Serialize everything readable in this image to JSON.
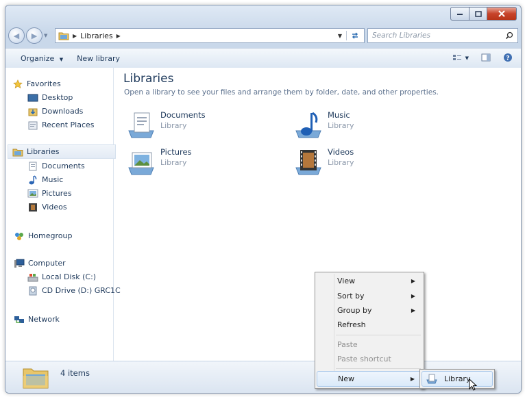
{
  "address": {
    "breadcrumb": "Libraries",
    "search_placeholder": "Search Libraries"
  },
  "toolbar": {
    "organize": "Organize",
    "new_library": "New library"
  },
  "nav": {
    "favorites": "Favorites",
    "desktop": "Desktop",
    "downloads": "Downloads",
    "recent": "Recent Places",
    "libraries": "Libraries",
    "documents": "Documents",
    "music": "Music",
    "pictures": "Pictures",
    "videos": "Videos",
    "homegroup": "Homegroup",
    "computer": "Computer",
    "local_disk": "Local Disk (C:)",
    "cd_drive": "CD Drive (D:) GRC1C",
    "network": "Network"
  },
  "content": {
    "title": "Libraries",
    "description": "Open a library to see your files and arrange them by folder, date, and other properties.",
    "libraries": [
      {
        "name": "Documents",
        "type": "Library"
      },
      {
        "name": "Music",
        "type": "Library"
      },
      {
        "name": "Pictures",
        "type": "Library"
      },
      {
        "name": "Videos",
        "type": "Library"
      }
    ]
  },
  "status": {
    "items": "4 items"
  },
  "context_menu": {
    "view": "View",
    "sort_by": "Sort by",
    "group_by": "Group by",
    "refresh": "Refresh",
    "paste": "Paste",
    "paste_shortcut": "Paste shortcut",
    "new": "New"
  },
  "submenu": {
    "library": "Library"
  },
  "colors": {
    "accent": "#1e395b",
    "close": "#c7432a",
    "selection": "#dbeaf9"
  }
}
